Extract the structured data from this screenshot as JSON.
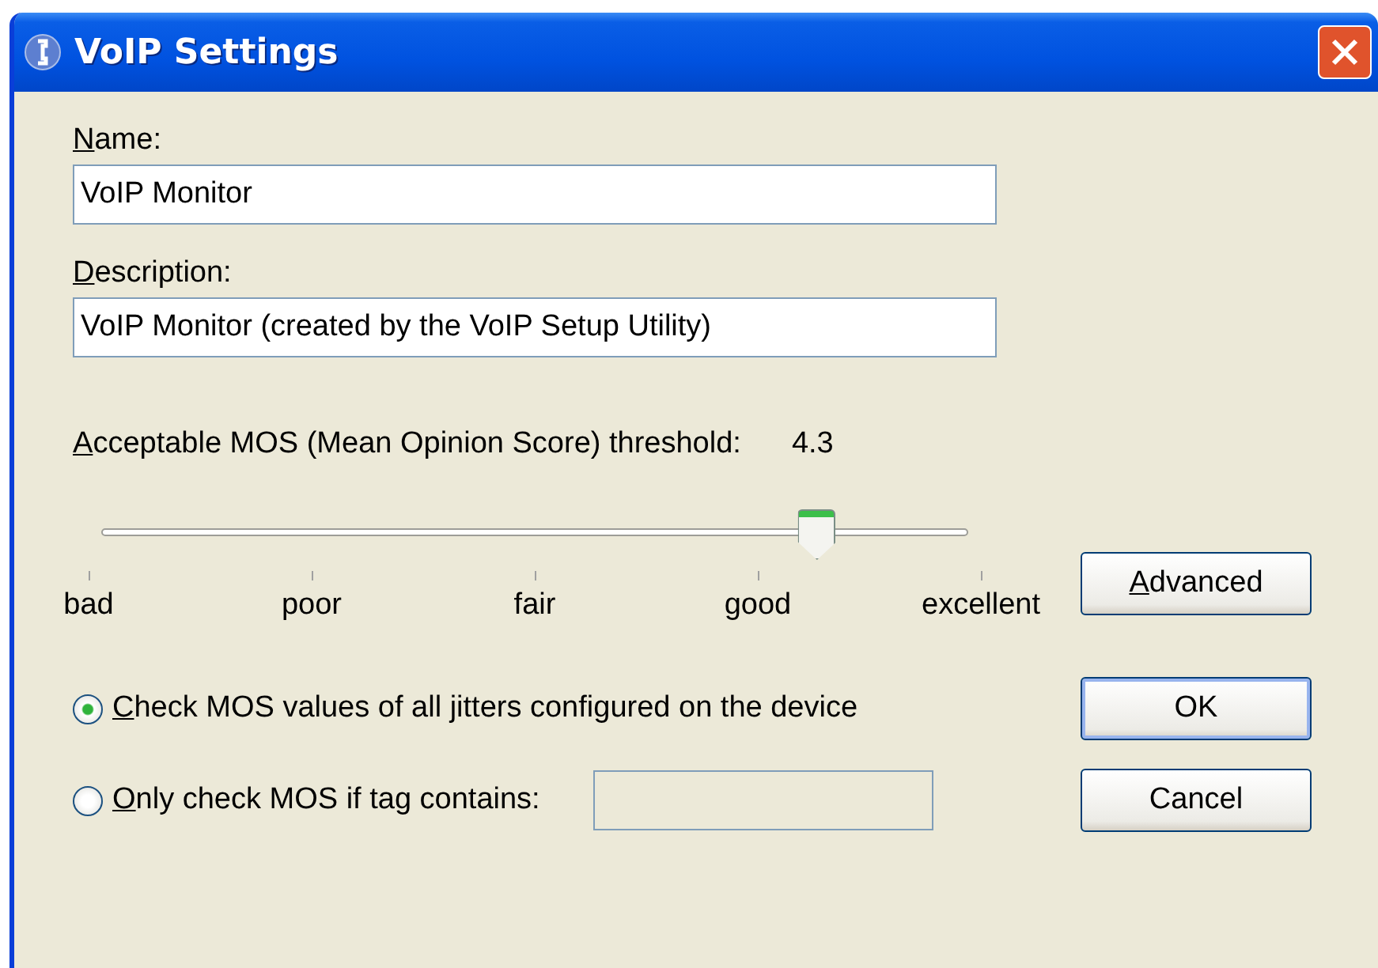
{
  "window": {
    "title": "VoIP Settings"
  },
  "name": {
    "label": "Name:",
    "value": "VoIP Monitor"
  },
  "description": {
    "label": "Description:",
    "value": "VoIP Monitor (created by the VoIP Setup Utility)"
  },
  "threshold": {
    "label": "Acceptable MOS (Mean Opinion Score) threshold:",
    "reading": "4.3",
    "level": 0.825,
    "scale": [
      "bad",
      "poor",
      "fair",
      "good",
      "excellent"
    ]
  },
  "options": [
    {
      "label": "Check MOS values of all jitters configured on the device",
      "selected": true
    },
    {
      "label": "Only check MOS if tag contains:",
      "selected": false
    }
  ],
  "buttons": {
    "advanced": "Advanced",
    "ok": "OK",
    "cancel": "Cancel"
  }
}
